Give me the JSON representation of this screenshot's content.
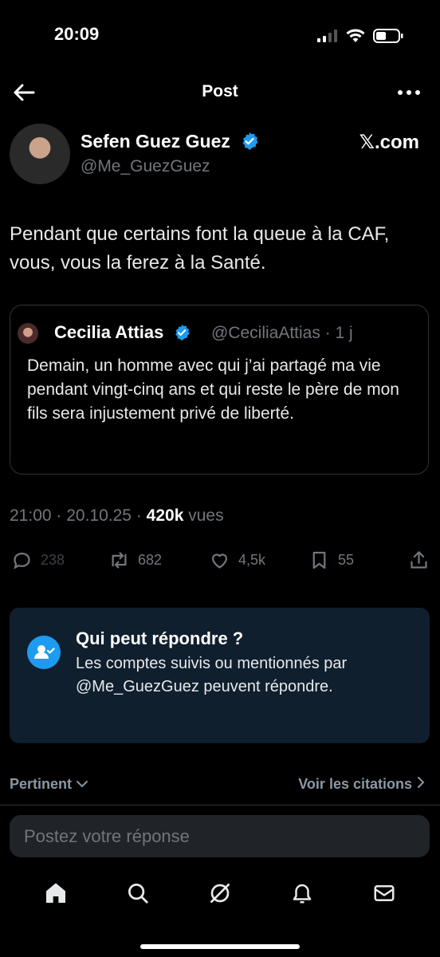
{
  "status_bar": {
    "time": "20:09"
  },
  "header": {
    "title": "Post"
  },
  "author": {
    "name": "Sefen Guez Guez",
    "handle": "@Me_GuezGuez",
    "source": "𝕏.com"
  },
  "tweet": {
    "text": "Pendant que certains font la queue à la CAF, vous, vous la ferez à la Santé."
  },
  "quote": {
    "name": "Cecilia Attias",
    "meta": "@CeciliaAttias · 1 j",
    "text": "Demain, un homme avec qui j’ai partagé ma vie pendant vingt-cinq ans et qui reste le père de mon fils sera injustement privé de liberté."
  },
  "meta": {
    "time": "21:00",
    "sep1": " · ",
    "date": "20.10.25",
    "sep2": " · ",
    "views": "420k",
    "views_label": " vues"
  },
  "actions": {
    "replies": "238",
    "reposts": "682",
    "likes": "4,5k",
    "bookmarks": "55"
  },
  "reply_restriction": {
    "title": "Qui peut répondre ?",
    "text": "Les comptes suivis ou mentionnés par @Me_GuezGuez peuvent répondre."
  },
  "sort": {
    "label": "Pertinent",
    "citations": "Voir les citations"
  },
  "reply_input": {
    "placeholder": "Postez votre réponse"
  },
  "colors": {
    "accent": "#1d9bf0",
    "muted": "#71767b",
    "background": "#000000"
  },
  "icons": [
    "back-arrow-icon",
    "more-icon",
    "verified-icon",
    "reply-icon",
    "repost-icon",
    "like-icon",
    "bookmark-icon",
    "share-icon",
    "person-check-icon",
    "chevron-down-icon",
    "chevron-right-icon",
    "home-icon",
    "search-icon",
    "grok-icon",
    "bell-icon",
    "mail-icon"
  ]
}
